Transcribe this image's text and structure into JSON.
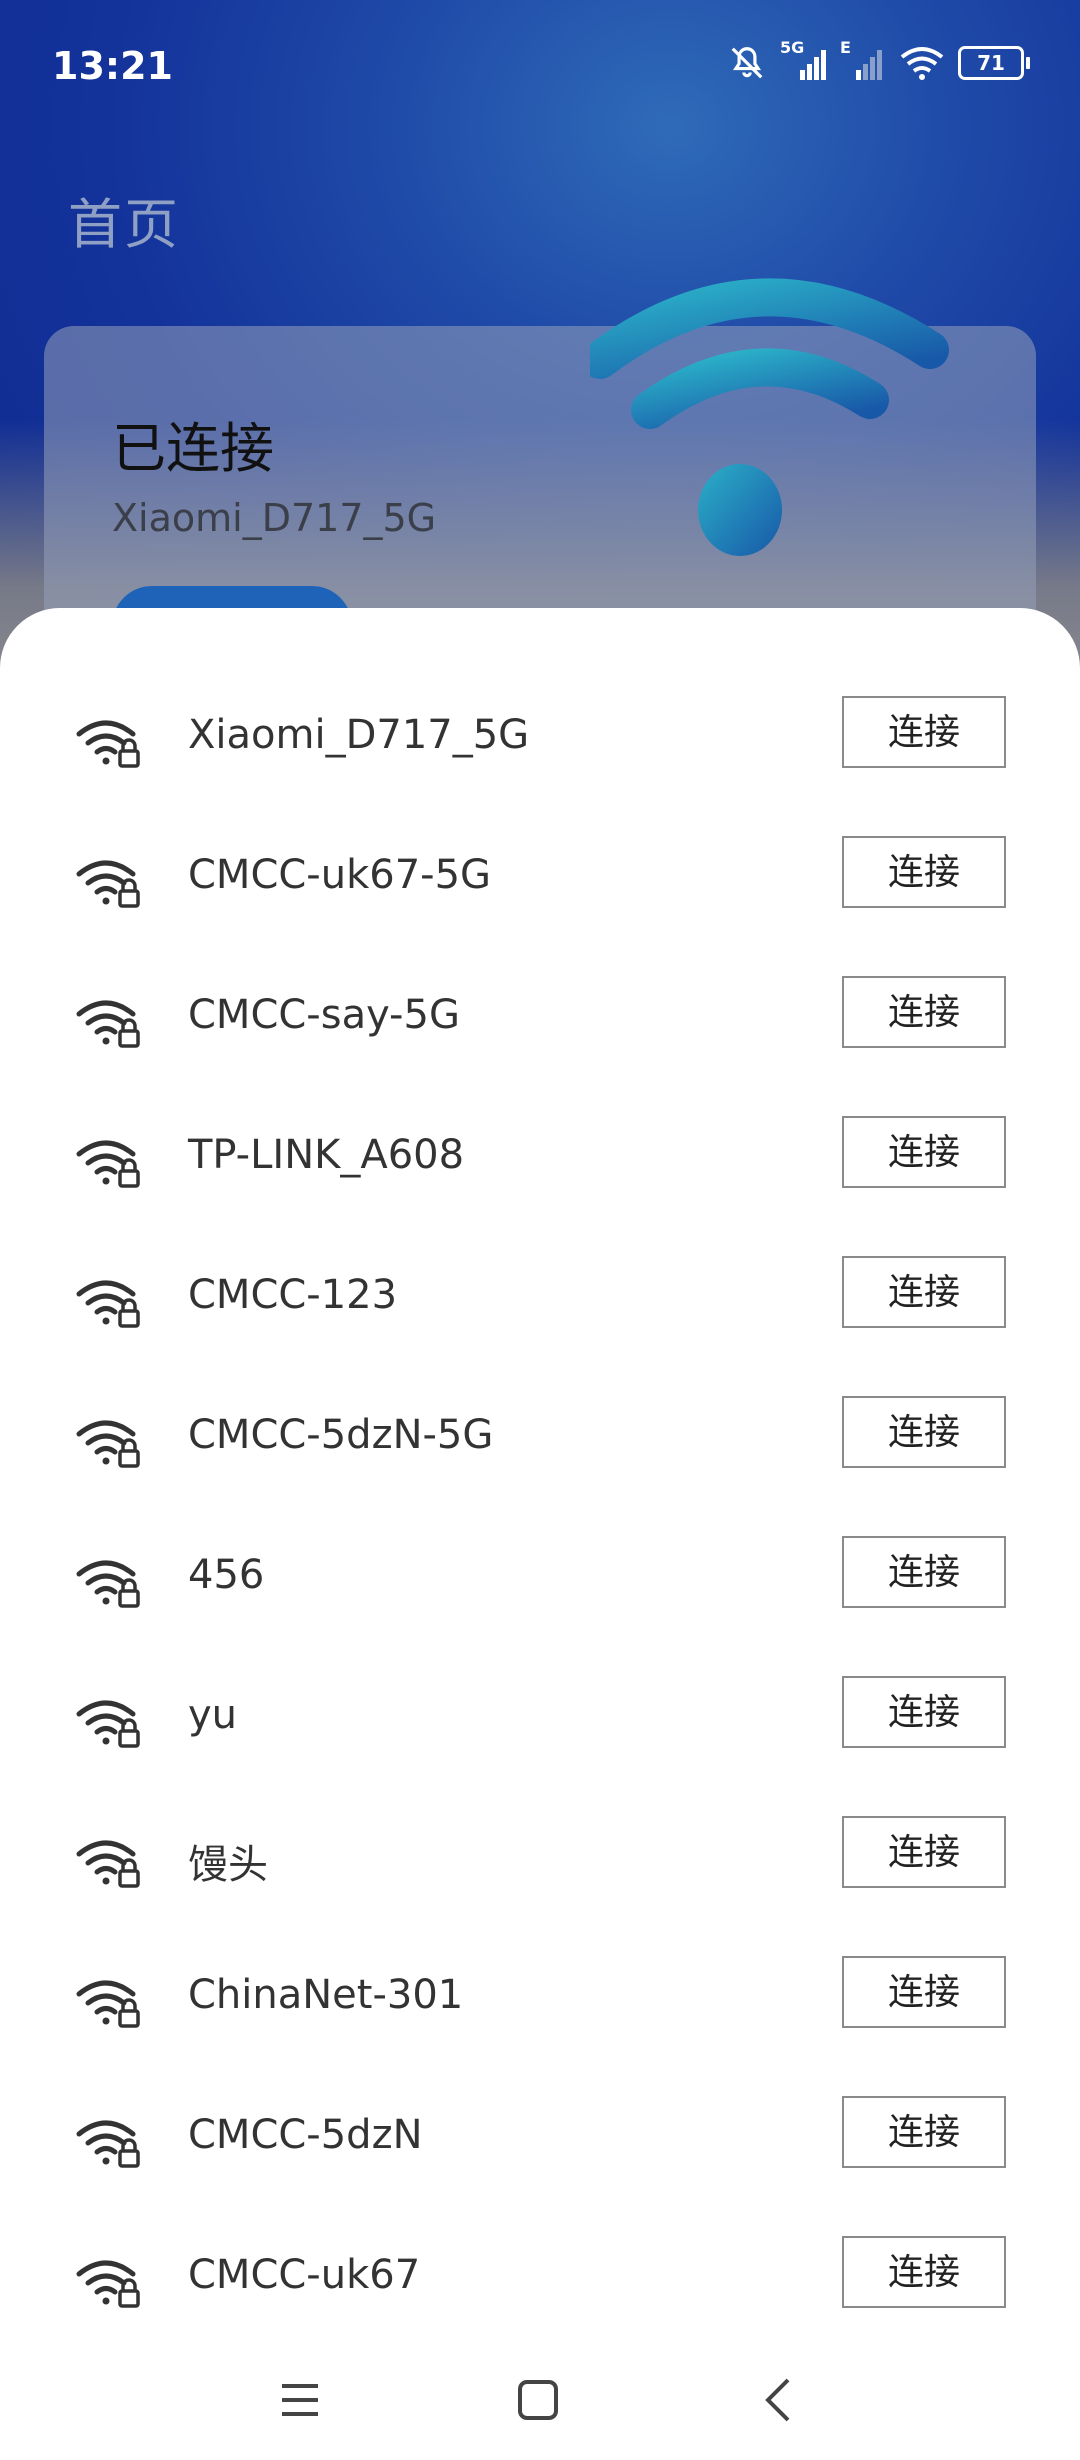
{
  "status_bar": {
    "time": "13:21",
    "signal_label": "5G",
    "data_label": "E",
    "battery": "71"
  },
  "background": {
    "page_title": "首页",
    "card_status": "已连接",
    "card_ssid": "Xiaomi_D717_5G"
  },
  "networks": [
    {
      "name": "Xiaomi_D717_5G",
      "button": "连接",
      "icon": "wifi-lock-icon"
    },
    {
      "name": "CMCC-uk67-5G",
      "button": "连接",
      "icon": "wifi-lock-icon"
    },
    {
      "name": "CMCC-say-5G",
      "button": "连接",
      "icon": "wifi-lock-icon"
    },
    {
      "name": "TP-LINK_A608",
      "button": "连接",
      "icon": "wifi-lock-icon"
    },
    {
      "name": "CMCC-123",
      "button": "连接",
      "icon": "wifi-lock-icon"
    },
    {
      "name": "CMCC-5dzN-5G",
      "button": "连接",
      "icon": "wifi-lock-icon"
    },
    {
      "name": "456",
      "button": "连接",
      "icon": "wifi-lock-icon"
    },
    {
      "name": "yu",
      "button": "连接",
      "icon": "wifi-lock-icon"
    },
    {
      "name": "馒头",
      "button": "连接",
      "icon": "wifi-lock-icon"
    },
    {
      "name": "ChinaNet-301",
      "button": "连接",
      "icon": "wifi-lock-icon"
    },
    {
      "name": "CMCC-5dzN",
      "button": "连接",
      "icon": "wifi-lock-icon"
    },
    {
      "name": "CMCC-uk67",
      "button": "连接",
      "icon": "wifi-lock-icon"
    }
  ],
  "nav": {
    "menu_icon": "menu-icon",
    "home_icon": "home-icon",
    "back_icon": "back-icon"
  },
  "colors": {
    "background_blue": "#13329a",
    "sheet": "#ffffff",
    "button_border": "#8a8a8a"
  }
}
